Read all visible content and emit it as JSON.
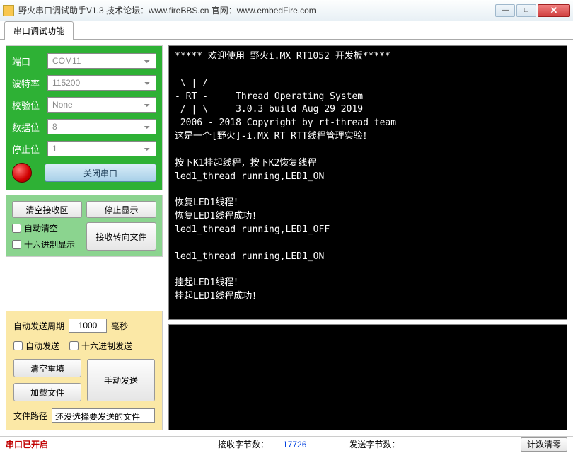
{
  "title": "野火串口调试助手V1.3     技术论坛：www.fireBBS.cn   官网：www.embedFire.com",
  "tab": "串口调试功能",
  "config": {
    "port_label": "端口",
    "port_value": "COM11",
    "baud_label": "波特率",
    "baud_value": "115200",
    "parity_label": "校验位",
    "parity_value": "None",
    "databits_label": "数据位",
    "databits_value": "8",
    "stopbits_label": "停止位",
    "stopbits_value": "1",
    "close_port": "关闭串口"
  },
  "recv_ctrl": {
    "clear_recv": "清空接收区",
    "stop_display": "停止显示",
    "auto_clear": "自动清空",
    "hex_display": "十六进制显示",
    "redirect_file": "接收转向文件"
  },
  "send_ctrl": {
    "period_label": "自动发送周期",
    "period_value": "1000",
    "period_unit": "毫秒",
    "auto_send": "自动发送",
    "hex_send": "十六进制发送",
    "clear_refill": "清空重填",
    "manual_send": "手动发送",
    "load_file": "加载文件",
    "file_label": "文件路径",
    "file_path": "还没选择要发送的文件"
  },
  "terminal_text": "***** 欢迎使用 野火i.MX RT1052 开发板*****\n\n \\ | /\n- RT -     Thread Operating System\n / | \\     3.0.3 build Aug 29 2019\n 2006 - 2018 Copyright by rt-thread team\n这是一个[野火]-i.MX RT RTT线程管理实验！\n\n按下K1挂起线程，按下K2恢复线程\nled1_thread running,LED1_ON\n\n恢复LED1线程！\n恢复LED1线程成功！\nled1_thread running,LED1_OFF\n\nled1_thread running,LED1_ON\n\n挂起LED1线程！\n挂起LED1线程成功！",
  "status": {
    "port_open": "串口已开启",
    "recv_bytes_label": "接收字节数：",
    "recv_bytes": "17726",
    "send_bytes_label": "发送字节数：",
    "send_bytes": "",
    "reset_counter": "计数清零"
  }
}
